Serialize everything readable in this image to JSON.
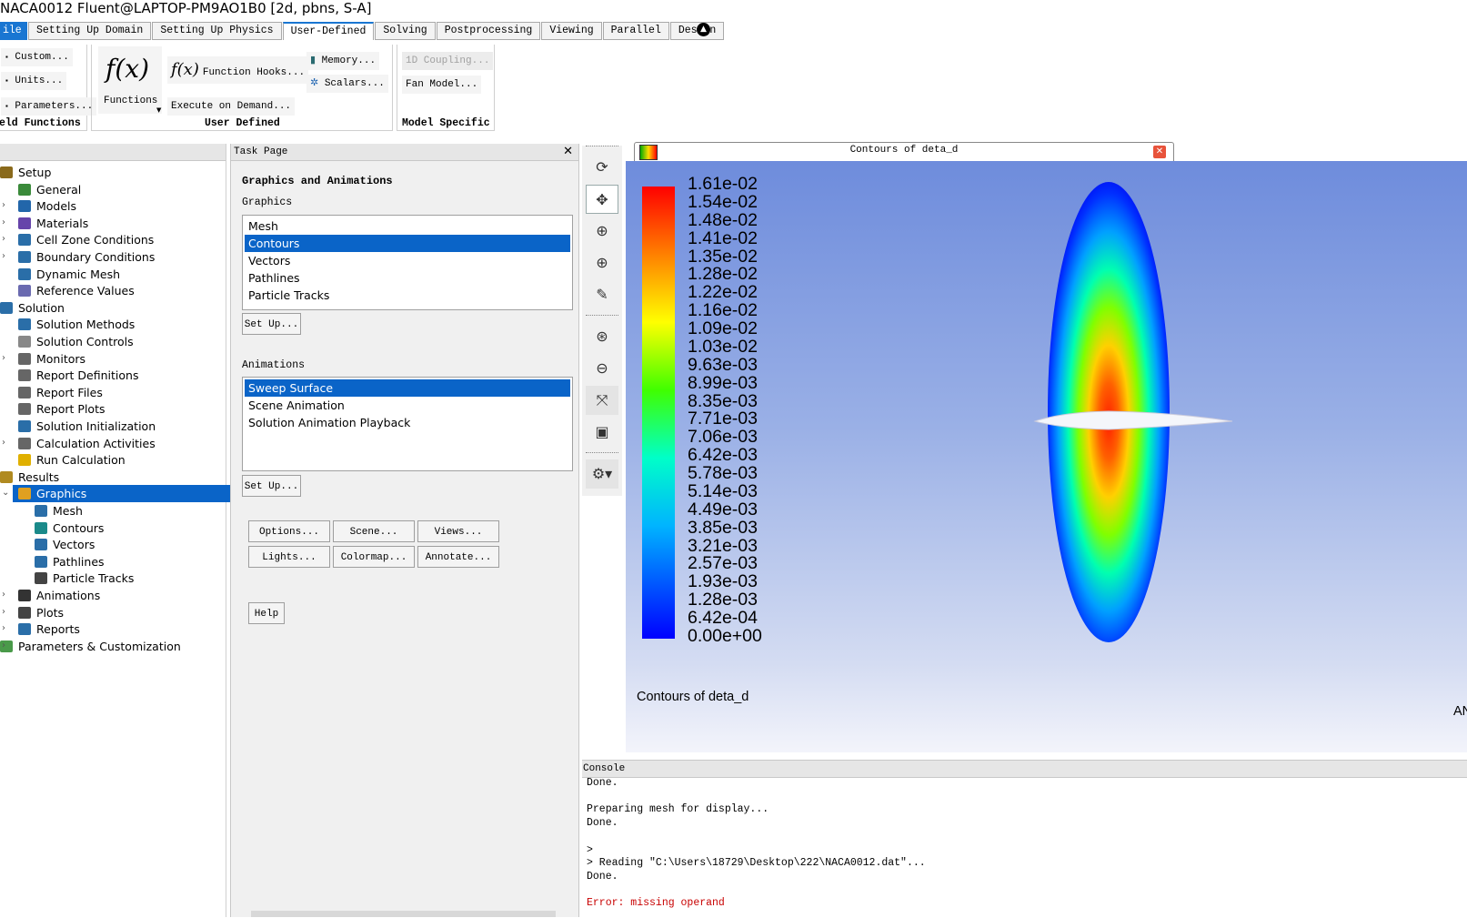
{
  "window": {
    "title": "NACA0012 Fluent@LAPTOP-PM9AO1B0  [2d, pbns, S-A]"
  },
  "ribbon_tabs": [
    "ile",
    "Setting Up Domain",
    "Setting Up Physics",
    "User-Defined",
    "Solving",
    "Postprocessing",
    "Viewing",
    "Parallel",
    "Design"
  ],
  "active_tab": "User-Defined",
  "ribbon": {
    "field_functions": {
      "custom": "Custom...",
      "units": "Units...",
      "parameters": "Parameters...",
      "label": "eld Functions"
    },
    "user_defined": {
      "functions": "Functions",
      "function_hooks": "Function Hooks...",
      "execute_on_demand": "Execute on Demand...",
      "memory": "Memory...",
      "scalars": "Scalars...",
      "label": "User Defined"
    },
    "model_specific": {
      "coupling_1d": "1D Coupling...",
      "fan_model": "Fan Model...",
      "label": "Model Specific"
    }
  },
  "tree": {
    "items": [
      {
        "label": "Setup",
        "icon": "setup-icon"
      },
      {
        "label": "General",
        "icon": "general-icon"
      },
      {
        "label": "Models",
        "icon": "models-icon"
      },
      {
        "label": "Materials",
        "icon": "materials-icon"
      },
      {
        "label": "Cell Zone Conditions",
        "icon": "cell-zone-icon"
      },
      {
        "label": "Boundary Conditions",
        "icon": "boundary-icon"
      },
      {
        "label": "Dynamic Mesh",
        "icon": "dynamic-mesh-icon"
      },
      {
        "label": "Reference Values",
        "icon": "reference-icon"
      },
      {
        "label": "Solution",
        "icon": "solution-icon"
      },
      {
        "label": "Solution Methods",
        "icon": "methods-icon"
      },
      {
        "label": "Solution Controls",
        "icon": "controls-icon"
      },
      {
        "label": "Monitors",
        "icon": "monitors-icon"
      },
      {
        "label": "Report Definitions",
        "icon": "report-def-icon"
      },
      {
        "label": "Report Files",
        "icon": "report-files-icon"
      },
      {
        "label": "Report Plots",
        "icon": "report-plots-icon"
      },
      {
        "label": "Solution Initialization",
        "icon": "init-icon"
      },
      {
        "label": "Calculation Activities",
        "icon": "calc-activities-icon"
      },
      {
        "label": "Run Calculation",
        "icon": "run-icon"
      },
      {
        "label": "Results",
        "icon": "results-icon"
      },
      {
        "label": "Graphics",
        "icon": "graphics-icon"
      },
      {
        "label": "Mesh",
        "icon": "mesh-icon"
      },
      {
        "label": "Contours",
        "icon": "contours-icon"
      },
      {
        "label": "Vectors",
        "icon": "vectors-icon"
      },
      {
        "label": "Pathlines",
        "icon": "pathlines-icon"
      },
      {
        "label": "Particle Tracks",
        "icon": "particle-tracks-icon"
      },
      {
        "label": "Animations",
        "icon": "animations-icon"
      },
      {
        "label": "Plots",
        "icon": "plots-icon"
      },
      {
        "label": "Reports",
        "icon": "reports-icon"
      },
      {
        "label": "Parameters & Customization",
        "icon": "parameters-icon"
      }
    ],
    "selected": "Graphics"
  },
  "task_page": {
    "header": "Task Page",
    "title": "Graphics and Animations",
    "graphics_label": "Graphics",
    "graphics_items": [
      "Mesh",
      "Contours",
      "Vectors",
      "Pathlines",
      "Particle Tracks"
    ],
    "graphics_selected": "Contours",
    "setup_button": "Set Up...",
    "animations_label": "Animations",
    "animation_items": [
      "Sweep Surface",
      "Scene Animation",
      "Solution Animation Playback"
    ],
    "animation_selected": "Sweep Surface",
    "setup_button2": "Set Up...",
    "buttons": [
      "Options...",
      "Scene...",
      "Views...",
      "Lights...",
      "Colormap...",
      "Annotate..."
    ],
    "help": "Help"
  },
  "graphics_window": {
    "tab_title": "Contours of deta_d",
    "caption": "Contours of deta_d",
    "corner_text": "AN",
    "colorbar": [
      "1.61e-02",
      "1.54e-02",
      "1.48e-02",
      "1.41e-02",
      "1.35e-02",
      "1.28e-02",
      "1.22e-02",
      "1.16e-02",
      "1.09e-02",
      "1.03e-02",
      "9.63e-03",
      "8.99e-03",
      "8.35e-03",
      "7.71e-03",
      "7.06e-03",
      "6.42e-03",
      "5.78e-03",
      "5.14e-03",
      "4.49e-03",
      "3.85e-03",
      "3.21e-03",
      "2.57e-03",
      "1.93e-03",
      "1.28e-03",
      "6.42e-04",
      "0.00e+00"
    ]
  },
  "console": {
    "header": "Console",
    "lines": [
      {
        "text": "Done.",
        "color": "#000000"
      },
      {
        "text": "",
        "color": "#000000"
      },
      {
        "text": "Preparing mesh for display...",
        "color": "#000000"
      },
      {
        "text": "Done.",
        "color": "#000000"
      },
      {
        "text": "",
        "color": "#000000"
      },
      {
        "text": ">",
        "color": "#000000"
      },
      {
        "text": "> Reading \"C:\\Users\\18729\\Desktop\\222\\NACA0012.dat\"...",
        "color": "#000000"
      },
      {
        "text": "Done.",
        "color": "#000000"
      },
      {
        "text": "",
        "color": "#000000"
      },
      {
        "text": "Error: missing operand",
        "color": "#c80000"
      }
    ]
  },
  "colors": {
    "selection": "#0a64c8",
    "accent": "#1976d2",
    "error": "#c80000"
  }
}
